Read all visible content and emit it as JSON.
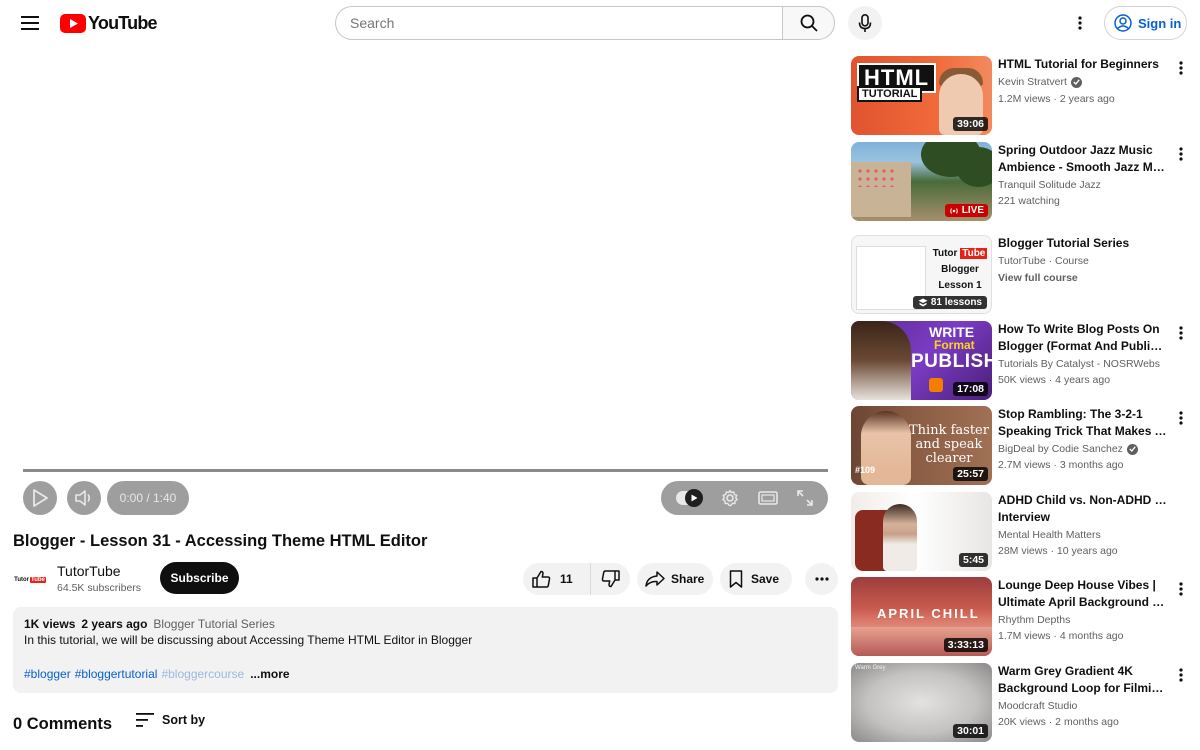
{
  "masthead": {
    "logo_text": "YouTube",
    "search_placeholder": "Search",
    "signin_label": "Sign in"
  },
  "player": {
    "time": "0:00 / 1:40",
    "progress": 0.0
  },
  "video": {
    "title": "Blogger - Lesson 31 - Accessing Theme HTML Editor",
    "channel": {
      "name": "TutorTube",
      "avatar_text_1": "Tutor",
      "avatar_text_2": "Tube",
      "subscribers": "64.5K subscribers",
      "subscribe_label": "Subscribe"
    },
    "actions": {
      "likes": "11",
      "share_label": "Share",
      "save_label": "Save"
    },
    "description": {
      "views": "1K views",
      "age": "2 years ago",
      "series": "Blogger Tutorial Series",
      "text": "In this tutorial, we will be discussing about Accessing Theme HTML Editor in Blogger",
      "tags": [
        "#blogger",
        "#bloggertutorial",
        "#bloggercourse"
      ],
      "more_label": "...more"
    },
    "comments": {
      "count_label": "0 Comments",
      "sort_label": "Sort by"
    }
  },
  "recommendations": [
    {
      "title_1": "HTML Tutorial for Beginners",
      "title_2": "",
      "channel": "Kevin Stratvert",
      "verified": true,
      "meta": "1.2M views · 2 years ago",
      "badge": "39:06",
      "thumb_text_1": "HTML",
      "thumb_text_2": "TUTORIAL"
    },
    {
      "title_1": "Spring Outdoor Jazz Music",
      "title_2": "Ambience - Smooth Jazz Musi…",
      "channel": "Tranquil Solitude Jazz",
      "meta": "221 watching",
      "badge": "LIVE"
    },
    {
      "title_1": "Blogger Tutorial Series",
      "channel": "TutorTube · Course",
      "meta": "View full course",
      "badge": "81 lessons",
      "thumb_text_1": "Tutor",
      "thumb_text_2": "Tube",
      "thumb_text_3": "Blogger",
      "thumb_text_4": "Lesson 1"
    },
    {
      "title_1": "How To Write Blog Posts On",
      "title_2": "Blogger (Format And Publish …",
      "channel": "Tutorials By Catalyst - NOSRWebs",
      "meta": "50K views · 4 years ago",
      "badge": "17:08",
      "thumb_text_1": "WRITE",
      "thumb_text_2": "Format",
      "thumb_text_3": "PUBLISH"
    },
    {
      "title_1": "Stop Rambling: The 3-2-1",
      "title_2": "Speaking Trick That Makes Yo…",
      "channel": "BigDeal by Codie Sanchez",
      "verified": true,
      "meta": "2.7M views · 3 months ago",
      "badge": "25:57",
      "thumb_text_1": "Think faster and speak clearer",
      "thumb_text_2": "#109"
    },
    {
      "title_1": "ADHD Child vs. Non-ADHD Child",
      "title_2": "Interview",
      "channel": "Mental Health Matters",
      "meta": "28M views · 10 years ago",
      "badge": "5:45"
    },
    {
      "title_1": "Lounge Deep House Vibes |",
      "title_2": "Ultimate April Background …",
      "channel": "Rhythm Depths",
      "meta": "1.7M views · 4 months ago",
      "badge": "3:33:13",
      "thumb_text_1": "APRIL CHILL"
    },
    {
      "title_1": "Warm Grey Gradient 4K",
      "title_2": "Background Loop for Filming …",
      "channel": "Moodcraft Studio",
      "meta": "20K views · 2 months ago",
      "badge": "30:01",
      "thumb_text_1": "Warm Grey"
    }
  ],
  "colors": {
    "brand_red": "#ff0000",
    "link_blue": "#065fd4",
    "live_red": "#cc0000"
  }
}
